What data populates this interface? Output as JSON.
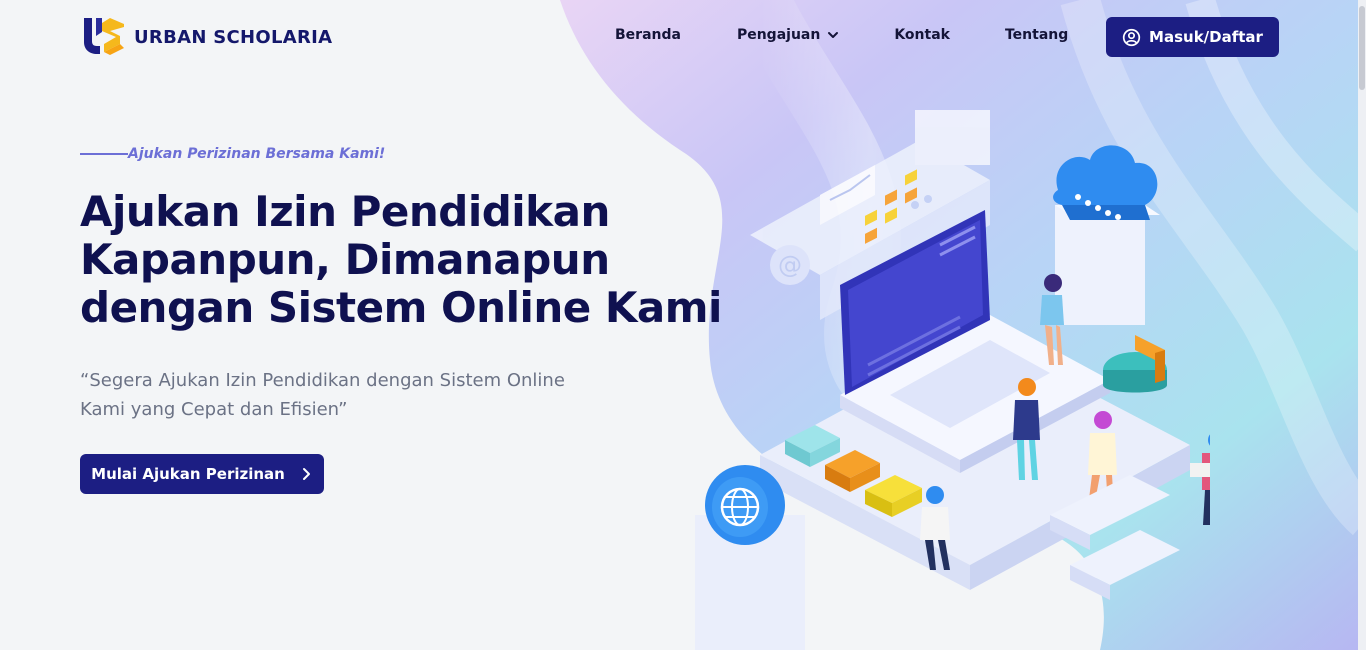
{
  "brand": {
    "name": "URBAN SCHOLARIA",
    "logo_icon": "us-logo-icon"
  },
  "nav": {
    "items": [
      {
        "label": "Beranda"
      },
      {
        "label": "Pengajuan",
        "has_dropdown": true
      },
      {
        "label": "Kontak"
      },
      {
        "label": "Tentang"
      }
    ],
    "login_label": "Masuk/Daftar",
    "login_icon": "user-circle-icon"
  },
  "hero": {
    "eyebrow": "Ajukan Perizinan Bersama Kami!",
    "title_lines": [
      "Ajukan Izin Pendidikan",
      "Kapanpun, Dimanapun",
      "dengan Sistem Online Kami"
    ],
    "subtitle_lines": [
      "“Segera Ajukan Izin Pendidikan dengan Sistem Online",
      "Kami yang Cepat dan Efisien”"
    ],
    "cta_label": "Mulai Ajukan Perizinan",
    "cta_icon": "chevron-right-icon"
  },
  "colors": {
    "primary": "#1c1e83",
    "accent": "#6c6fd6",
    "heading": "#0f1150",
    "muted": "#6b7285",
    "background": "#f3f5f7"
  }
}
